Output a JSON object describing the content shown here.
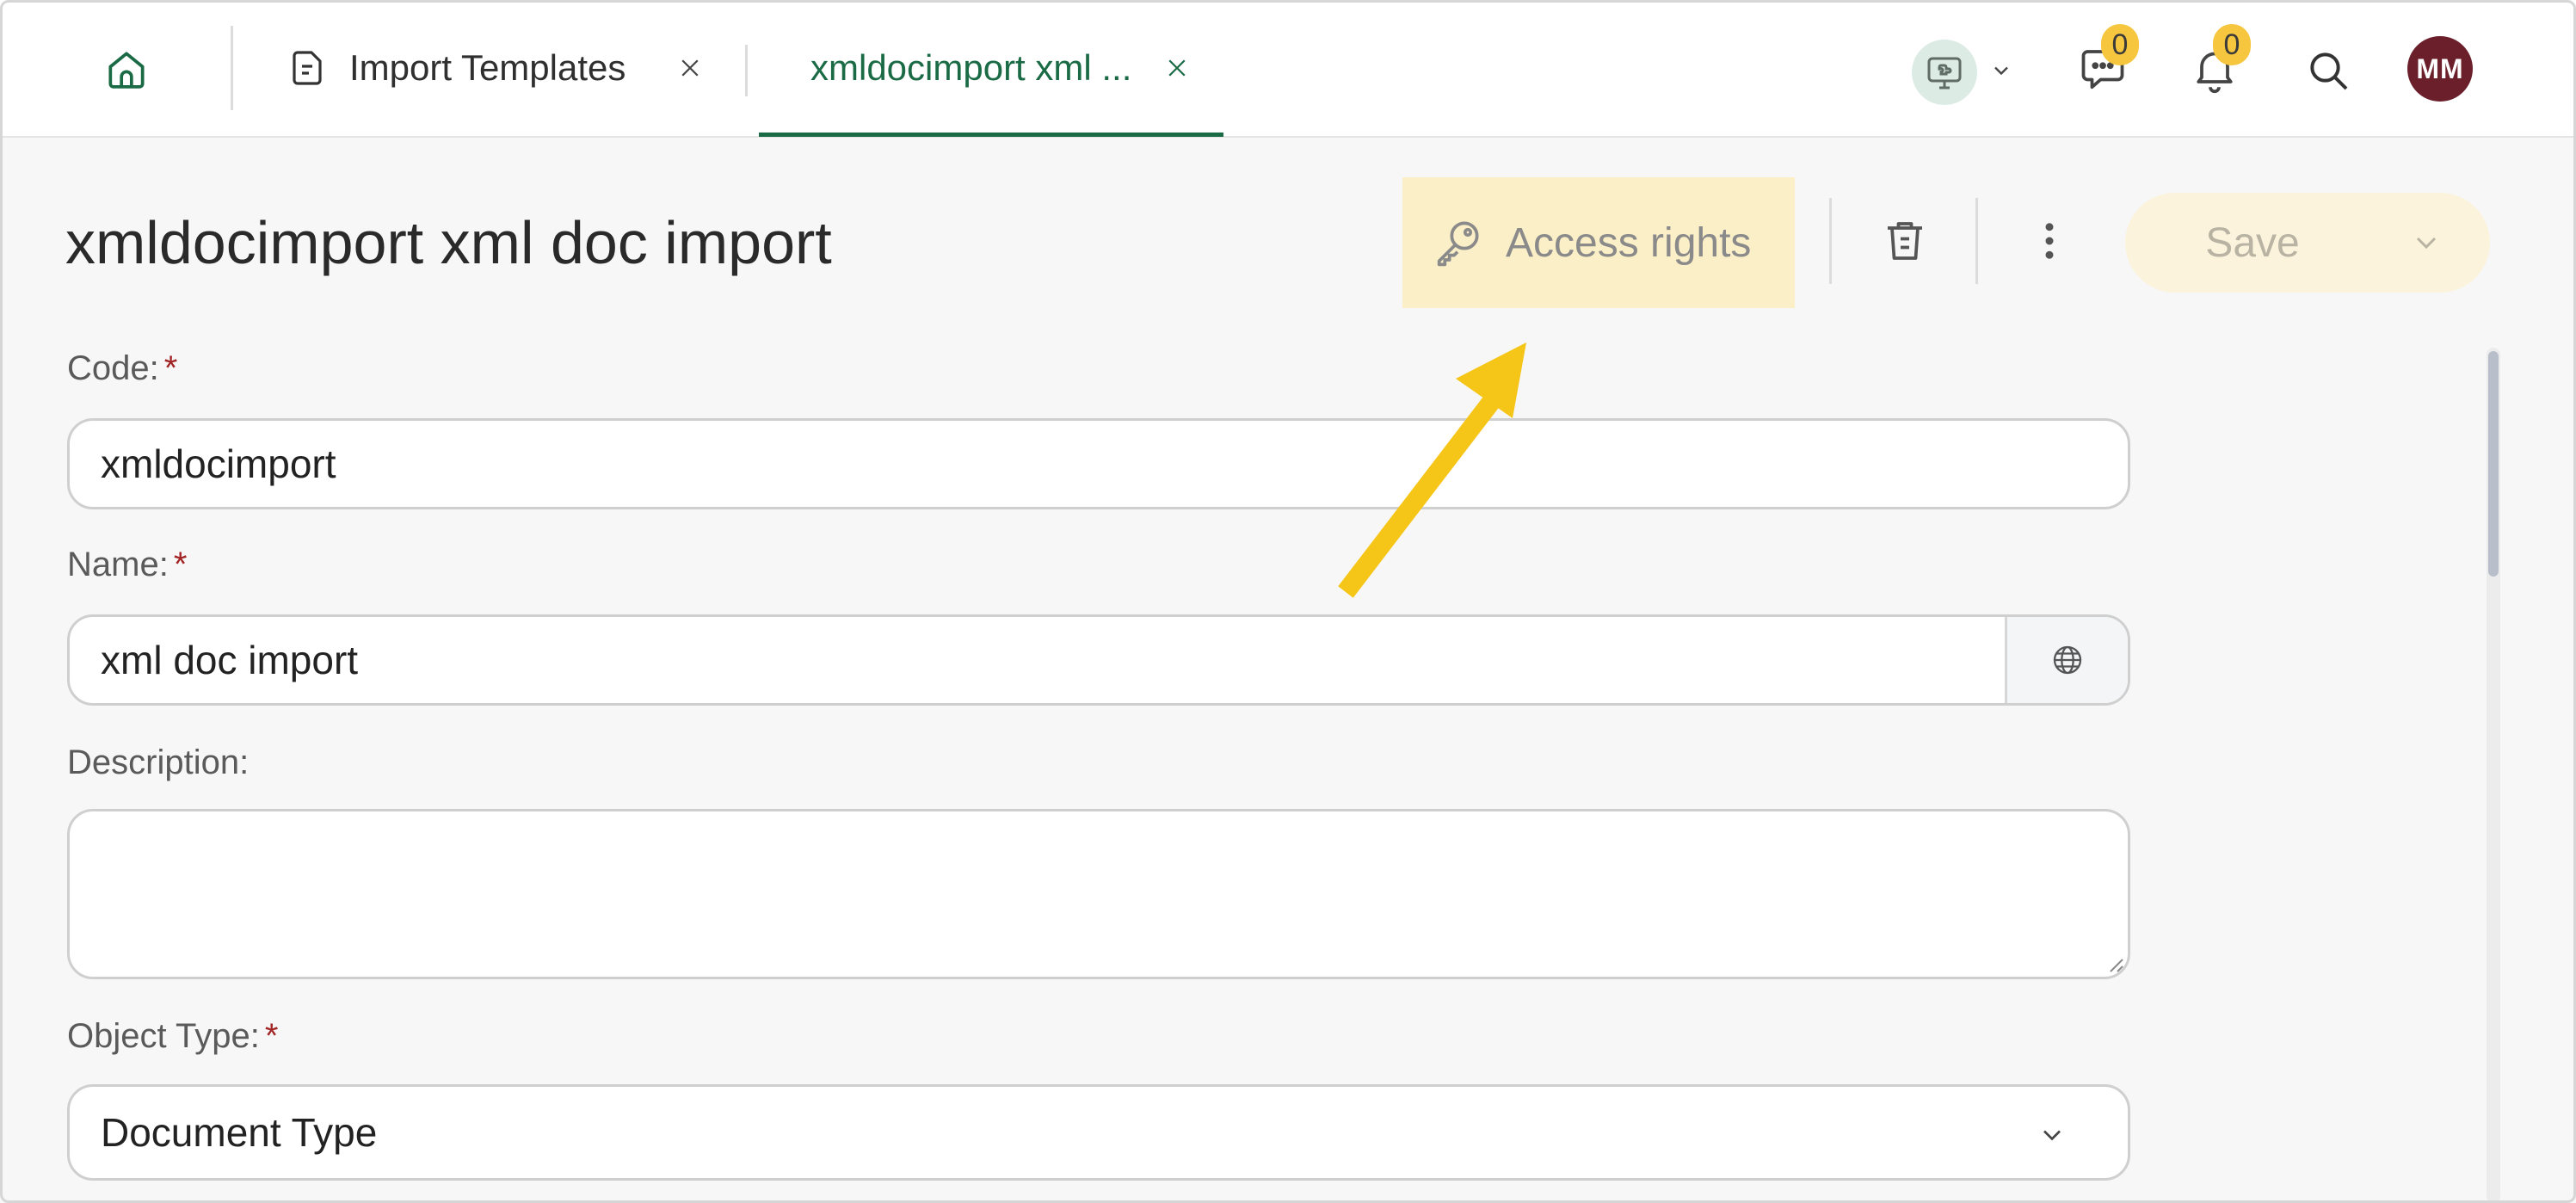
{
  "tabs": [
    {
      "label": "Import Templates",
      "icon": "document-icon",
      "active": false
    },
    {
      "label": "xmldocimport xml ...",
      "active": true
    }
  ],
  "topbar": {
    "chat_badge": "0",
    "notifications_badge": "0",
    "avatar_initials": "MM"
  },
  "page": {
    "title": "xmldocimport xml doc import"
  },
  "toolbar": {
    "access_rights_label": "Access rights",
    "save_label": "Save"
  },
  "form": {
    "code": {
      "label": "Code:",
      "required_mark": "*",
      "value": "xmldocimport"
    },
    "name": {
      "label": "Name:",
      "required_mark": "*",
      "value": "xml doc import"
    },
    "description": {
      "label": "Description:",
      "value": ""
    },
    "object_type": {
      "label": "Object Type:",
      "required_mark": "*",
      "value": "Document Type"
    }
  },
  "colors": {
    "accent": "#1a6b45",
    "highlight": "#fbefc7",
    "badge": "#f6c63e",
    "annotation_arrow": "#f5c518",
    "avatar": "#6b1f2a"
  }
}
